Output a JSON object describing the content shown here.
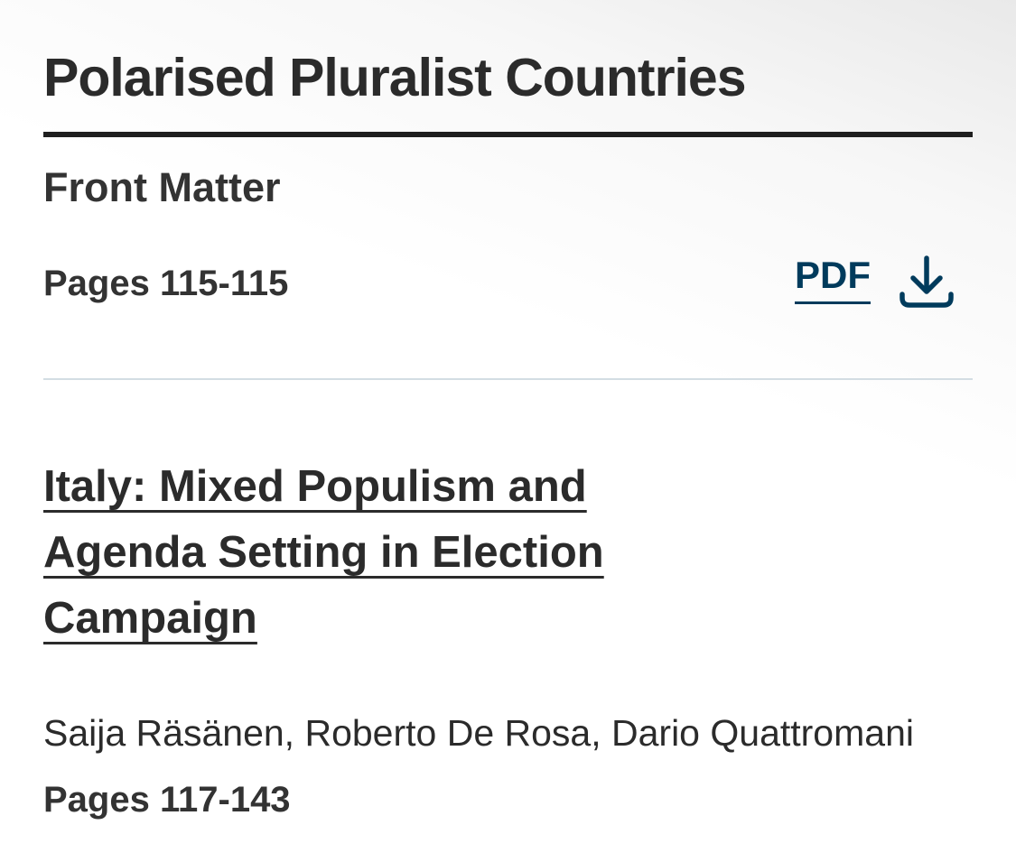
{
  "section": {
    "title": "Polarised Pluralist Countries"
  },
  "front_matter": {
    "title": "Front Matter",
    "pages": "Pages 115-115",
    "pdf_label": "PDF",
    "download_icon": "download-icon"
  },
  "chapter": {
    "title": "Italy: Mixed Populism and Agenda Setting in Election Campaign",
    "authors": "Saija Räsänen, Roberto De Rosa, Dario Quattromani",
    "pages": "Pages 117-143"
  },
  "colors": {
    "link_accent": "#003b5c",
    "heading_text": "#2b2b2b",
    "divider": "#d3dde3"
  }
}
